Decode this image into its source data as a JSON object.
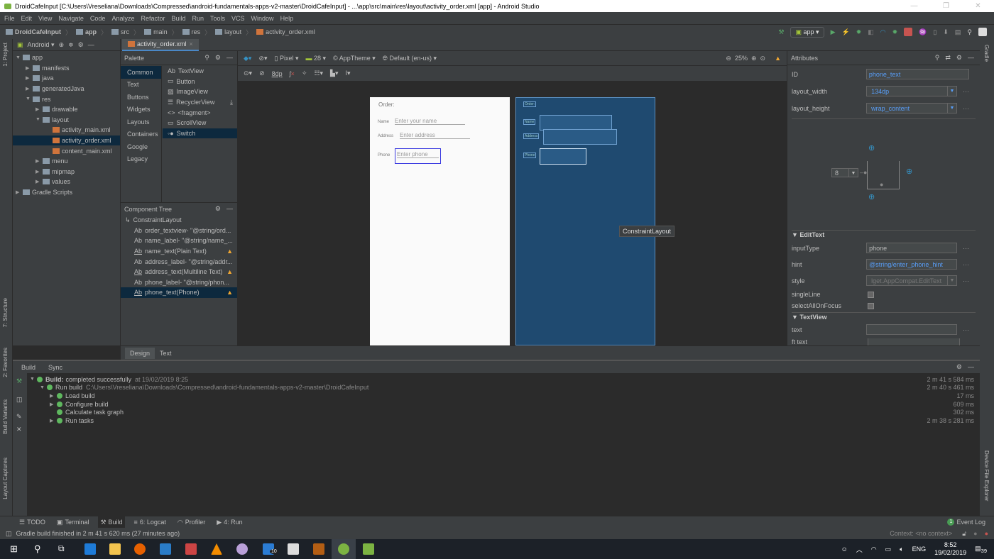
{
  "window": {
    "title": "DroidCafeInput [C:\\Users\\Vreseliana\\Downloads\\Compressed\\android-fundamentals-apps-v2-master\\DroidCafeInput] - ...\\app\\src\\main\\res\\layout\\activity_order.xml [app] - Android Studio",
    "minimize": "—",
    "maximize": "❐",
    "close": "✕"
  },
  "menu": [
    "File",
    "Edit",
    "View",
    "Navigate",
    "Code",
    "Analyze",
    "Refactor",
    "Build",
    "Run",
    "Tools",
    "VCS",
    "Window",
    "Help"
  ],
  "breadcrumb": [
    "DroidCafeInput",
    "app",
    "src",
    "main",
    "res",
    "layout",
    "activity_order.xml"
  ],
  "toolbar": {
    "config": "app"
  },
  "project": {
    "view": "Android",
    "tree": [
      {
        "label": "app",
        "level": 0,
        "arrow": "▼"
      },
      {
        "label": "manifests",
        "level": 1,
        "arrow": "▶"
      },
      {
        "label": "java",
        "level": 1,
        "arrow": "▶"
      },
      {
        "label": "generatedJava",
        "level": 1,
        "arrow": "▶"
      },
      {
        "label": "res",
        "level": 1,
        "arrow": "▼"
      },
      {
        "label": "drawable",
        "level": 2,
        "arrow": "▶"
      },
      {
        "label": "layout",
        "level": 2,
        "arrow": "▼"
      },
      {
        "label": "activity_main.xml",
        "level": 3,
        "arrow": ""
      },
      {
        "label": "activity_order.xml",
        "level": 3,
        "arrow": "",
        "selected": true
      },
      {
        "label": "content_main.xml",
        "level": 3,
        "arrow": ""
      },
      {
        "label": "menu",
        "level": 2,
        "arrow": "▶"
      },
      {
        "label": "mipmap",
        "level": 2,
        "arrow": "▶"
      },
      {
        "label": "values",
        "level": 2,
        "arrow": "▶"
      },
      {
        "label": "Gradle Scripts",
        "level": 0,
        "arrow": "▶"
      }
    ]
  },
  "side_tabs": {
    "project": "1: Project",
    "structure": "7: Structure",
    "favorites": "2: Favorites",
    "variants": "Build Variants",
    "captures": "Layout Captures",
    "gradle": "Gradle",
    "device": "Device File Explorer"
  },
  "editor_tab": "activity_order.xml",
  "palette": {
    "title": "Palette",
    "categories": [
      "Common",
      "Text",
      "Buttons",
      "Widgets",
      "Layouts",
      "Containers",
      "Google",
      "Legacy"
    ],
    "items": [
      {
        "icon": "Ab",
        "label": "TextView"
      },
      {
        "icon": "▭",
        "label": "Button"
      },
      {
        "icon": "▨",
        "label": "ImageView"
      },
      {
        "icon": "☰",
        "label": "RecyclerView"
      },
      {
        "icon": "<>",
        "label": "<fragment>"
      },
      {
        "icon": "▭",
        "label": "ScrollView"
      },
      {
        "icon": "◦●",
        "label": "Switch"
      }
    ]
  },
  "component_tree": {
    "title": "Component Tree",
    "root": "ConstraintLayout",
    "items": [
      {
        "label": "order_textview- \"@string/ord...",
        "warn": false
      },
      {
        "label": "name_label- \"@string/name_...",
        "warn": false
      },
      {
        "label": "name_text(Plain Text)",
        "warn": true
      },
      {
        "label": "address_label- \"@string/addr...",
        "warn": false
      },
      {
        "label": "address_text(Multiline Text)",
        "warn": true
      },
      {
        "label": "phone_label- \"@string/phon...",
        "warn": false
      },
      {
        "label": "phone_text(Phone)",
        "warn": true,
        "selected": true
      }
    ]
  },
  "design_toolbar": {
    "device": "Pixel",
    "api": "28",
    "theme": "AppTheme",
    "locale": "Default (en-us)",
    "zoom": "25%",
    "margin": "8dp"
  },
  "preview": {
    "order": "Order:",
    "name_label": "Name",
    "name_hint": "Enter your name",
    "address_label": "Address",
    "address_hint": "Enter address",
    "phone_label": "Phone",
    "phone_hint": "Enter phone",
    "bp_order": "Order:",
    "bp_name": "Name",
    "bp_address": "Address",
    "bp_phone": "Phone"
  },
  "tooltip": "ConstraintLayout",
  "attributes": {
    "title": "Attributes",
    "id_label": "ID",
    "id": "phone_text",
    "width_label": "layout_width",
    "width": "134dp",
    "height_label": "layout_height",
    "height": "wrap_content",
    "margin": "8",
    "edittext_section": "EditText",
    "inputType_label": "inputType",
    "inputType": "phone",
    "hint_label": "hint",
    "hint": "@string/enter_phone_hint",
    "style_label": "style",
    "style": "lget.AppCompat.EditText",
    "singleLine": "singleLine",
    "selectAll": "selectAllOnFocus",
    "textview_section": "TextView",
    "text_label": "text",
    "ftext_label": "ft text"
  },
  "design_tabs": [
    "Design",
    "Text"
  ],
  "build": {
    "tabs": [
      "Build",
      "Sync"
    ],
    "rows": [
      {
        "label": "Build:",
        "rest": "completed successfully",
        "extra": "at 19/02/2019 8:25",
        "time": "2 m 41 s 584 ms",
        "indent": 0,
        "arrow": "▼"
      },
      {
        "label": "Run build",
        "extra": "C:\\Users\\Vreseliana\\Downloads\\Compressed\\android-fundamentals-apps-v2-master\\DroidCafeInput",
        "time": "2 m 40 s 461 ms",
        "indent": 1,
        "arrow": "▼"
      },
      {
        "label": "Load build",
        "time": "17 ms",
        "indent": 2,
        "arrow": "▶"
      },
      {
        "label": "Configure build",
        "time": "609 ms",
        "indent": 2,
        "arrow": "▶"
      },
      {
        "label": "Calculate task graph",
        "time": "302 ms",
        "indent": 2,
        "arrow": ""
      },
      {
        "label": "Run tasks",
        "time": "2 m 38 s 281 ms",
        "indent": 2,
        "arrow": "▶"
      }
    ]
  },
  "tool_windows": [
    {
      "icon": "☰",
      "label": "TODO"
    },
    {
      "icon": "▣",
      "label": "Terminal"
    },
    {
      "icon": "⚒",
      "label": "Build",
      "selected": true
    },
    {
      "icon": "≡",
      "label": "6: Logcat"
    },
    {
      "icon": "◠",
      "label": "Profiler"
    },
    {
      "icon": "▶",
      "label": "4: Run"
    }
  ],
  "event_log": {
    "count": "1",
    "label": "Event Log"
  },
  "status": {
    "message": "Gradle build finished in 2 m 41 s 620 ms (27 minutes ago)",
    "context": "Context: <no context>"
  },
  "taskbar": {
    "outlook_badge": "10",
    "lang": "ENG",
    "time": "8:52",
    "date": "19/02/2019",
    "notifications": "39"
  },
  "colors": {
    "accent": "#589df6",
    "selection": "#0d293e",
    "success": "#5fb85f",
    "warning": "#f0a732"
  }
}
